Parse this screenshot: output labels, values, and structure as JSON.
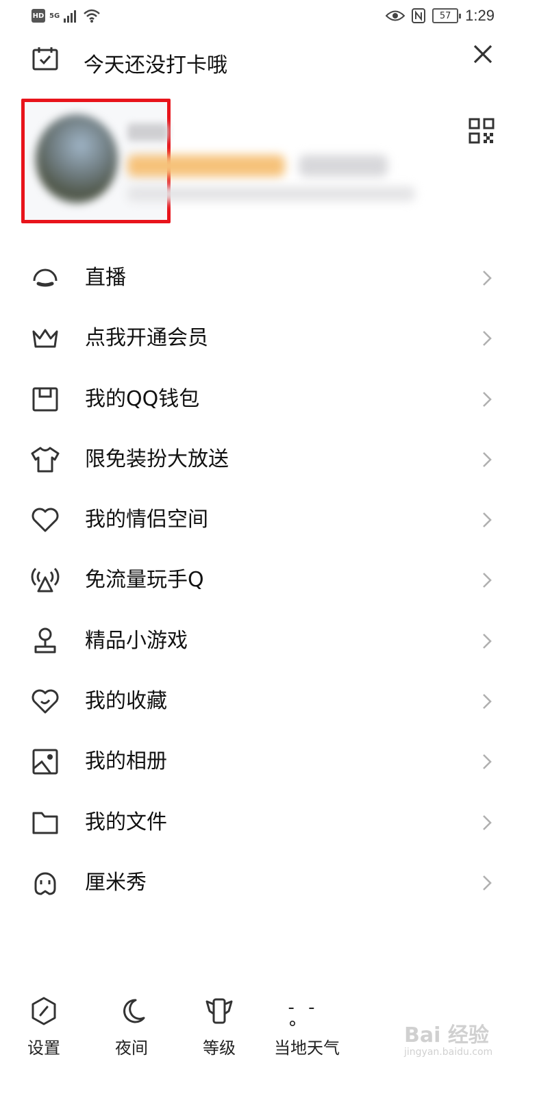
{
  "status_bar": {
    "hd": "HD",
    "network": "5G",
    "battery": "57",
    "time": "1:29"
  },
  "header": {
    "checkin_text": "今天还没打卡哦"
  },
  "menu": [
    {
      "label": "直播",
      "icon": "live-icon"
    },
    {
      "label": "点我开通会员",
      "icon": "crown-icon"
    },
    {
      "label": "我的QQ钱包",
      "icon": "wallet-icon"
    },
    {
      "label": "限免装扮大放送",
      "icon": "tshirt-icon"
    },
    {
      "label": "我的情侣空间",
      "icon": "heart-icon"
    },
    {
      "label": "免流量玩手Q",
      "icon": "signal-tower-icon"
    },
    {
      "label": "精品小游戏",
      "icon": "joystick-icon"
    },
    {
      "label": "我的收藏",
      "icon": "favorite-heart-icon"
    },
    {
      "label": "我的相册",
      "icon": "album-icon"
    },
    {
      "label": "我的文件",
      "icon": "folder-icon"
    },
    {
      "label": "厘米秀",
      "icon": "cmshow-icon"
    }
  ],
  "bottom_bar": [
    {
      "label": "设置",
      "icon": "settings-icon"
    },
    {
      "label": "夜间",
      "icon": "moon-icon"
    },
    {
      "label": "等级",
      "icon": "level-icon"
    },
    {
      "label": "当地天气",
      "icon": "weather-icon",
      "glyph": "- -°"
    }
  ],
  "watermark": {
    "text": "Bai 经验",
    "sub": "jingyan.baidu.com"
  },
  "colors": {
    "highlight_border": "#e8141b",
    "icon_stroke": "#333333",
    "chevron": "#b0b0b0"
  }
}
